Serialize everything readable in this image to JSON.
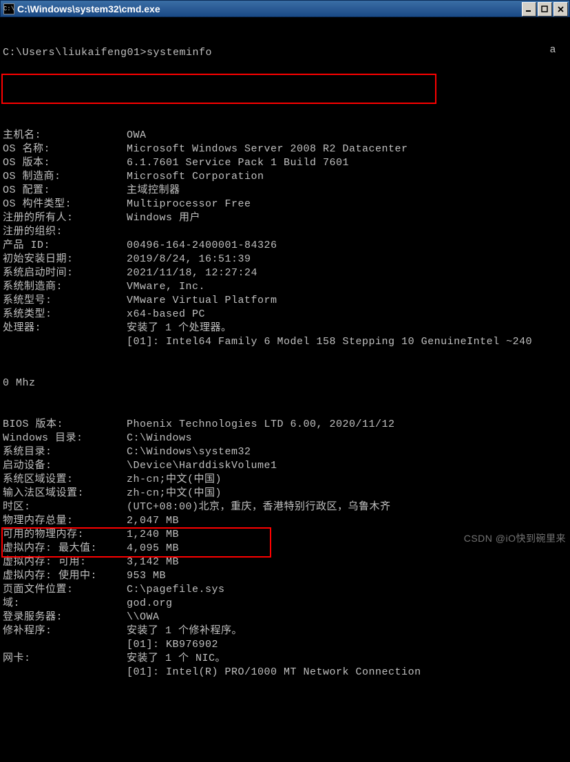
{
  "window": {
    "title": "C:\\Windows\\system32\\cmd.exe",
    "icon_label": "C:\\"
  },
  "prompt": "C:\\Users\\liukaifeng01>",
  "command": "systeminfo",
  "float_char": "a",
  "lines": [
    {
      "label": "主机名:",
      "value": "OWA"
    },
    {
      "label": "OS 名称:",
      "value": "Microsoft Windows Server 2008 R2 Datacenter"
    },
    {
      "label": "OS 版本:",
      "value": "6.1.7601 Service Pack 1 Build 7601"
    },
    {
      "label": "OS 制造商:",
      "value": "Microsoft Corporation"
    },
    {
      "label": "OS 配置:",
      "value": "主域控制器"
    },
    {
      "label": "OS 构件类型:",
      "value": "Multiprocessor Free"
    },
    {
      "label": "注册的所有人:",
      "value": "Windows 用户"
    },
    {
      "label": "注册的组织:",
      "value": ""
    },
    {
      "label": "产品 ID:",
      "value": "00496-164-2400001-84326"
    },
    {
      "label": "初始安装日期:",
      "value": "2019/8/24, 16:51:39"
    },
    {
      "label": "系统启动时间:",
      "value": "2021/11/18, 12:27:24"
    },
    {
      "label": "系统制造商:",
      "value": "VMware, Inc."
    },
    {
      "label": "系统型号:",
      "value": "VMware Virtual Platform"
    },
    {
      "label": "系统类型:",
      "value": "x64-based PC"
    },
    {
      "label": "处理器:",
      "value": "安装了 1 个处理器。"
    },
    {
      "label": "",
      "value": "[01]: Intel64 Family 6 Model 158 Stepping 10 GenuineIntel ~240"
    }
  ],
  "wrap_line": "0 Mhz",
  "lines2": [
    {
      "label": "BIOS 版本:",
      "value": "Phoenix Technologies LTD 6.00, 2020/11/12"
    },
    {
      "label": "Windows 目录:",
      "value": "C:\\Windows"
    },
    {
      "label": "系统目录:",
      "value": "C:\\Windows\\system32"
    },
    {
      "label": "启动设备:",
      "value": "\\Device\\HarddiskVolume1"
    },
    {
      "label": "系统区域设置:",
      "value": "zh-cn;中文(中国)"
    },
    {
      "label": "输入法区域设置:",
      "value": "zh-cn;中文(中国)"
    },
    {
      "label": "时区:",
      "value": "(UTC+08:00)北京，重庆，香港特别行政区，乌鲁木齐"
    },
    {
      "label": "物理内存总量:",
      "value": "2,047 MB"
    },
    {
      "label": "可用的物理内存:",
      "value": "1,240 MB"
    },
    {
      "label": "虚拟内存: 最大值:",
      "value": "4,095 MB"
    },
    {
      "label": "虚拟内存: 可用:",
      "value": "3,142 MB"
    },
    {
      "label": "虚拟内存: 使用中:",
      "value": "953 MB"
    },
    {
      "label": "页面文件位置:",
      "value": "C:\\pagefile.sys"
    },
    {
      "label": "域:",
      "value": "god.org"
    },
    {
      "label": "登录服务器:",
      "value": "\\\\OWA"
    },
    {
      "label": "修补程序:",
      "value": "安装了 1 个修补程序。"
    },
    {
      "label": "",
      "value": "[01]: KB976902"
    },
    {
      "label": "网卡:",
      "value": "安装了 1 个 NIC。"
    },
    {
      "label": "",
      "value": "[01]: Intel(R) PRO/1000 MT Network Connection"
    }
  ],
  "watermark": "CSDN @iO快到碗里来"
}
